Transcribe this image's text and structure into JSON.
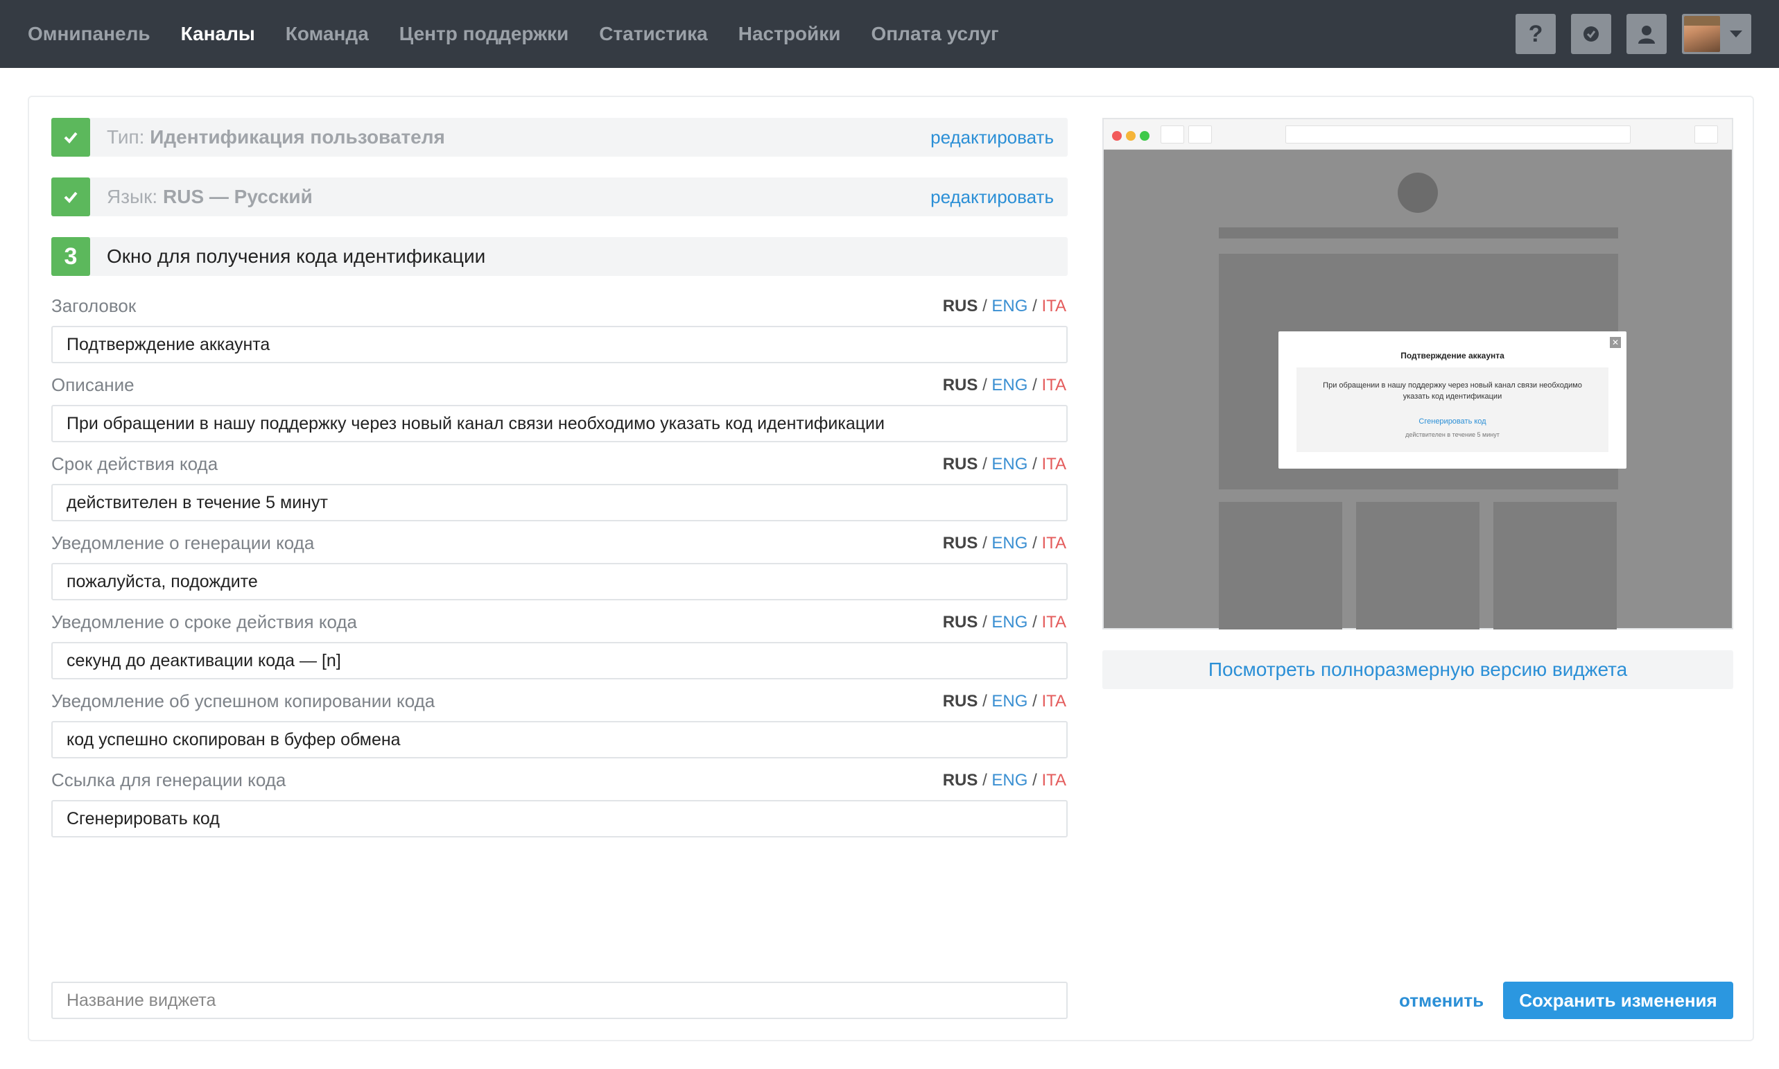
{
  "nav": {
    "items": [
      {
        "label": "Омнипанель",
        "active": false
      },
      {
        "label": "Каналы",
        "active": true
      },
      {
        "label": "Команда",
        "active": false
      },
      {
        "label": "Центр поддержки",
        "active": false
      },
      {
        "label": "Статистика",
        "active": false
      },
      {
        "label": "Настройки",
        "active": false
      },
      {
        "label": "Оплата услуг",
        "active": false
      }
    ],
    "help_icon": "question-icon",
    "status_icon": "checkmark-badge-icon",
    "user_icon": "user-icon",
    "help_glyph": "?"
  },
  "steps": [
    {
      "prefix": "Тип:",
      "value": "Идентификация пользователя",
      "edit": "редактировать",
      "done": true
    },
    {
      "prefix": "Язык:",
      "value": "RUS — Русский",
      "edit": "редактировать",
      "done": true
    },
    {
      "number": "3",
      "title": "Окно для получения кода идентификации",
      "done": false
    }
  ],
  "languages": {
    "rus": "RUS",
    "eng": "ENG",
    "ita": "ITA",
    "sep": "/"
  },
  "fields": [
    {
      "label": "Заголовок",
      "value": "Подтверждение аккаунта"
    },
    {
      "label": "Описание",
      "value": "При обращении в нашу поддержку через новый канал связи необходимо указать код идентификации"
    },
    {
      "label": "Срок действия кода",
      "value": "действителен в течение 5 минут"
    },
    {
      "label": "Уведомление о генерации кода",
      "value": "пожалуйста, подождите"
    },
    {
      "label": "Уведомление о сроке действия кода",
      "value": "секунд до деактивации кода — [n]"
    },
    {
      "label": "Уведомление об успешном копировании кода",
      "value": "код успешно скопирован в буфер обмена"
    },
    {
      "label": "Ссылка для генерации кода",
      "value": "Сгенерировать код"
    }
  ],
  "widget_name": {
    "placeholder": "Название виджета"
  },
  "preview": {
    "modal_title": "Подтверждение аккаунта",
    "modal_desc": "При обращении в нашу поддержку через новый канал связи необходимо указать код идентификации",
    "modal_link": "Сгенерировать код",
    "modal_sub": "действителен в течение 5 минут",
    "close_glyph": "✕",
    "fullsize_label": "Посмотреть полноразмерную версию виджета"
  },
  "actions": {
    "cancel": "отменить",
    "save": "Сохранить изменения"
  },
  "colors": {
    "accent": "#2b8fd6",
    "success": "#5cb85c",
    "ita": "#e45c5c",
    "nav_bg": "#353b43"
  }
}
